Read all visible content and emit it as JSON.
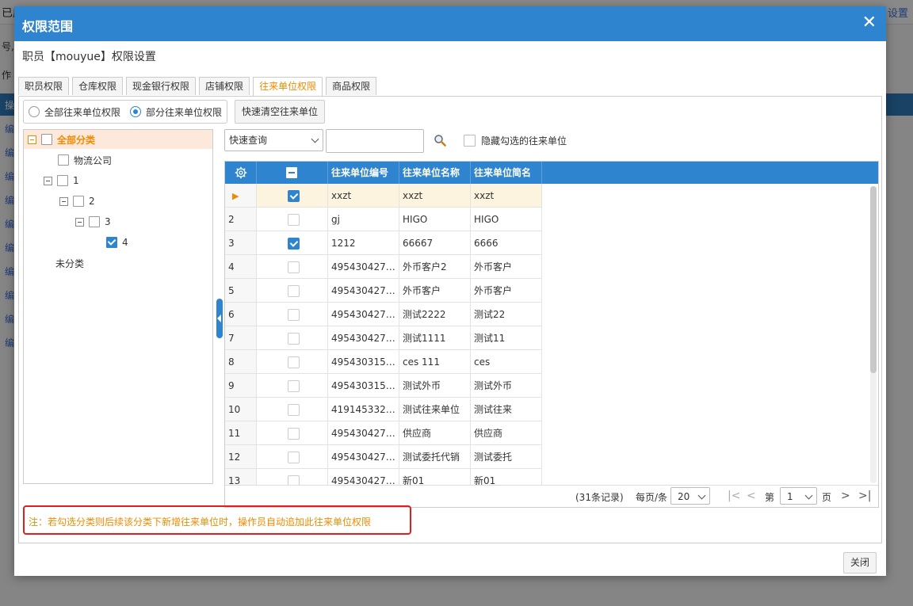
{
  "background": {
    "top_left_text": "已库",
    "top_right_text": "设置",
    "left_texts": [
      "号,是",
      "作"
    ],
    "blue_bar_text": "操",
    "edit_labels": [
      "编",
      "编",
      "编",
      "编",
      "编",
      "编",
      "编",
      "编",
      "编",
      "编"
    ]
  },
  "dialog": {
    "title": "权限范围",
    "subtitle": "职员【mouyue】权限设置",
    "close_label": "关闭"
  },
  "tabs": [
    {
      "label": "职员权限",
      "active": false
    },
    {
      "label": "仓库权限",
      "active": false
    },
    {
      "label": "现金银行权限",
      "active": false
    },
    {
      "label": "店铺权限",
      "active": false
    },
    {
      "label": "往来单位权限",
      "active": true
    },
    {
      "label": "商品权限",
      "active": false
    }
  ],
  "scope": {
    "all_label": "全部往来单位权限",
    "partial_label": "部分往来单位权限",
    "selected": "partial",
    "clear_button": "快速清空往来单位"
  },
  "tree": [
    {
      "label": "全部分类",
      "expander": true,
      "checked": false,
      "selected": true
    },
    {
      "label": "物流公司",
      "expander": false,
      "checked": false
    },
    {
      "label": "1",
      "expander": true,
      "checked": false
    },
    {
      "label": "2",
      "expander": true,
      "checked": false
    },
    {
      "label": "3",
      "expander": true,
      "checked": false
    },
    {
      "label": "4",
      "expander": false,
      "checked": true
    },
    {
      "label": "未分类",
      "expander": false,
      "checkbox": false
    }
  ],
  "filter": {
    "query_mode": "快速查询",
    "search_value": "",
    "hide_checked_label": "隐藏勾选的往来单位",
    "hide_checked": false
  },
  "grid": {
    "columns": [
      "往来单位编号",
      "往来单位名称",
      "往来单位简名"
    ],
    "rows": [
      {
        "no": "",
        "current": true,
        "checked": true,
        "code": "xxzt",
        "name": "xxzt",
        "short": "xxzt"
      },
      {
        "no": "2",
        "checked": false,
        "code": "gj",
        "name": "HIGO",
        "short": "HIGO"
      },
      {
        "no": "3",
        "checked": true,
        "code": "1212",
        "name": "66667",
        "short": "6666"
      },
      {
        "no": "4",
        "checked": false,
        "code": "4954304272...",
        "name": "外币客户2",
        "short": "外币客户"
      },
      {
        "no": "5",
        "checked": false,
        "code": "4954304272...",
        "name": "外币客户",
        "short": "外币客户"
      },
      {
        "no": "6",
        "checked": false,
        "code": "4954304272...",
        "name": "测试2222",
        "short": "测试22"
      },
      {
        "no": "7",
        "checked": false,
        "code": "4954304272...",
        "name": "测试1111",
        "short": "测试11"
      },
      {
        "no": "8",
        "checked": false,
        "code": "4954303154...",
        "name": "ces 111",
        "short": "ces"
      },
      {
        "no": "9",
        "checked": false,
        "code": "4954303154...",
        "name": "测试外币",
        "short": "测试外币"
      },
      {
        "no": "10",
        "checked": false,
        "code": "4191453321...",
        "name": "测试往来单位",
        "short": "测试往来"
      },
      {
        "no": "11",
        "checked": false,
        "code": "4954304272...",
        "name": "供应商",
        "short": "供应商"
      },
      {
        "no": "12",
        "checked": false,
        "code": "4954304272...",
        "name": "测试委托代销",
        "short": "测试委托"
      },
      {
        "no": "13",
        "checked": false,
        "code": "4954304272...",
        "name": "新01",
        "short": "新01"
      }
    ]
  },
  "pager": {
    "records": "(31条记录)",
    "per_page_label": "每页/条",
    "page_size": "20",
    "page_prefix": "第",
    "page": "1",
    "page_suffix": "页"
  },
  "note": "注：若勾选分类则后续该分类下新增往来单位时，操作员自动追加此往来单位权限",
  "colors": {
    "primary": "#2e84cf",
    "accent_orange": "#f08a00",
    "note_border": "#e02020"
  }
}
